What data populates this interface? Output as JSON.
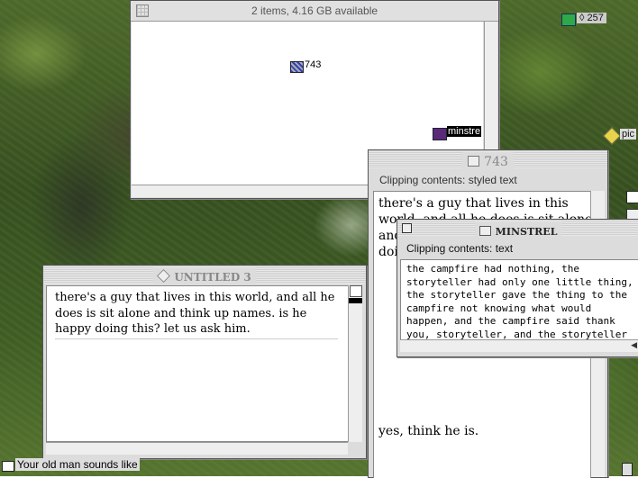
{
  "desktop": {
    "topright_badge": "257",
    "pic_label": "pic",
    "bottom_label": "Your old man sounds like"
  },
  "finder_window": {
    "status": "2 items, 4.16 GB available",
    "items": [
      {
        "label": "743"
      },
      {
        "label": "minstre"
      }
    ]
  },
  "clip_743": {
    "title": "743",
    "header": "Clipping contents: styled text",
    "text_lines": [
      "there's a guy that lives in this",
      "world, and all he does is sit alone",
      "and",
      "doi"
    ],
    "bottom_text": "yes, think he is."
  },
  "minstrel": {
    "title": "MINSTREL",
    "header": "Clipping contents: text",
    "text": "the campfire had nothing, the storyteller had only one little thing, the storyteller gave the thing to the campfire not knowing what would happen, and the campfire said thank you, storyteller, and the storyteller was free to go"
  },
  "untitled": {
    "title": "UNTITLED 3",
    "text": "there's a guy that lives in this world, and all he does is sit alone and think up names. is he happy doing this? let us ask him."
  }
}
